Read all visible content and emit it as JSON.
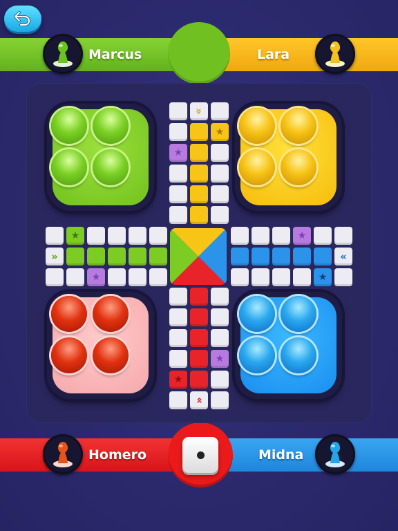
{
  "players": {
    "top_left": {
      "name": "Marcus",
      "color": "#76c32c"
    },
    "top_right": {
      "name": "Lara",
      "color": "#f5b417"
    },
    "bottom_left": {
      "name": "Homero",
      "color": "#e51e1e"
    },
    "bottom_right": {
      "name": "Midna",
      "color": "#2895e6"
    }
  },
  "colors": {
    "green": "#7dcc24",
    "yellow": "#f7c515",
    "red": "#e8242a",
    "blue": "#2b93ea",
    "star_purple": "#b77be0",
    "cell_white": "#ececf2",
    "board_bg": "#2c2a6e"
  },
  "icons": {
    "back": "back-arrow-icon",
    "pawn": "pawn-icon",
    "star": "star-icon",
    "arrow": "double-chevron-icon"
  },
  "dice": {
    "value": 1
  },
  "glyphs": {
    "star": "★",
    "down": "»",
    "right": "»",
    "left": "«",
    "up": "»"
  }
}
